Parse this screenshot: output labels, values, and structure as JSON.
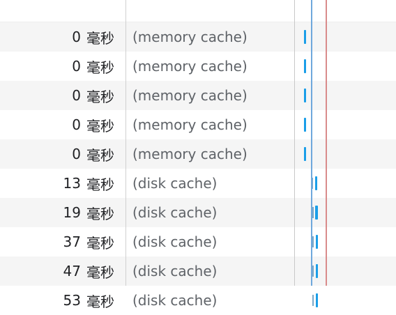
{
  "rows": [
    {
      "time": "",
      "unit": "",
      "size": "",
      "bar": "none"
    },
    {
      "time": "0",
      "unit": "毫秒",
      "size": "(memory cache)",
      "bar": "memory"
    },
    {
      "time": "0",
      "unit": "毫秒",
      "size": "(memory cache)",
      "bar": "memory"
    },
    {
      "time": "0",
      "unit": "毫秒",
      "size": "(memory cache)",
      "bar": "memory"
    },
    {
      "time": "0",
      "unit": "毫秒",
      "size": "(memory cache)",
      "bar": "memory"
    },
    {
      "time": "0",
      "unit": "毫秒",
      "size": "(memory cache)",
      "bar": "memory"
    },
    {
      "time": "13",
      "unit": "毫秒",
      "size": "(disk cache)",
      "bar": "disk"
    },
    {
      "time": "19",
      "unit": "毫秒",
      "size": "(disk cache)",
      "bar": "disk"
    },
    {
      "time": "37",
      "unit": "毫秒",
      "size": "(disk cache)",
      "bar": "disk"
    },
    {
      "time": "47",
      "unit": "毫秒",
      "size": "(disk cache)",
      "bar": "disk"
    },
    {
      "time": "53",
      "unit": "毫秒",
      "size": "(disk cache)",
      "bar": "disk"
    }
  ],
  "colors": {
    "bar_blue": "#1a9ee8",
    "dom_content_loaded_line": "#6fa8dc",
    "load_line": "#d98b8b",
    "row_stripe": "#f5f5f5"
  }
}
